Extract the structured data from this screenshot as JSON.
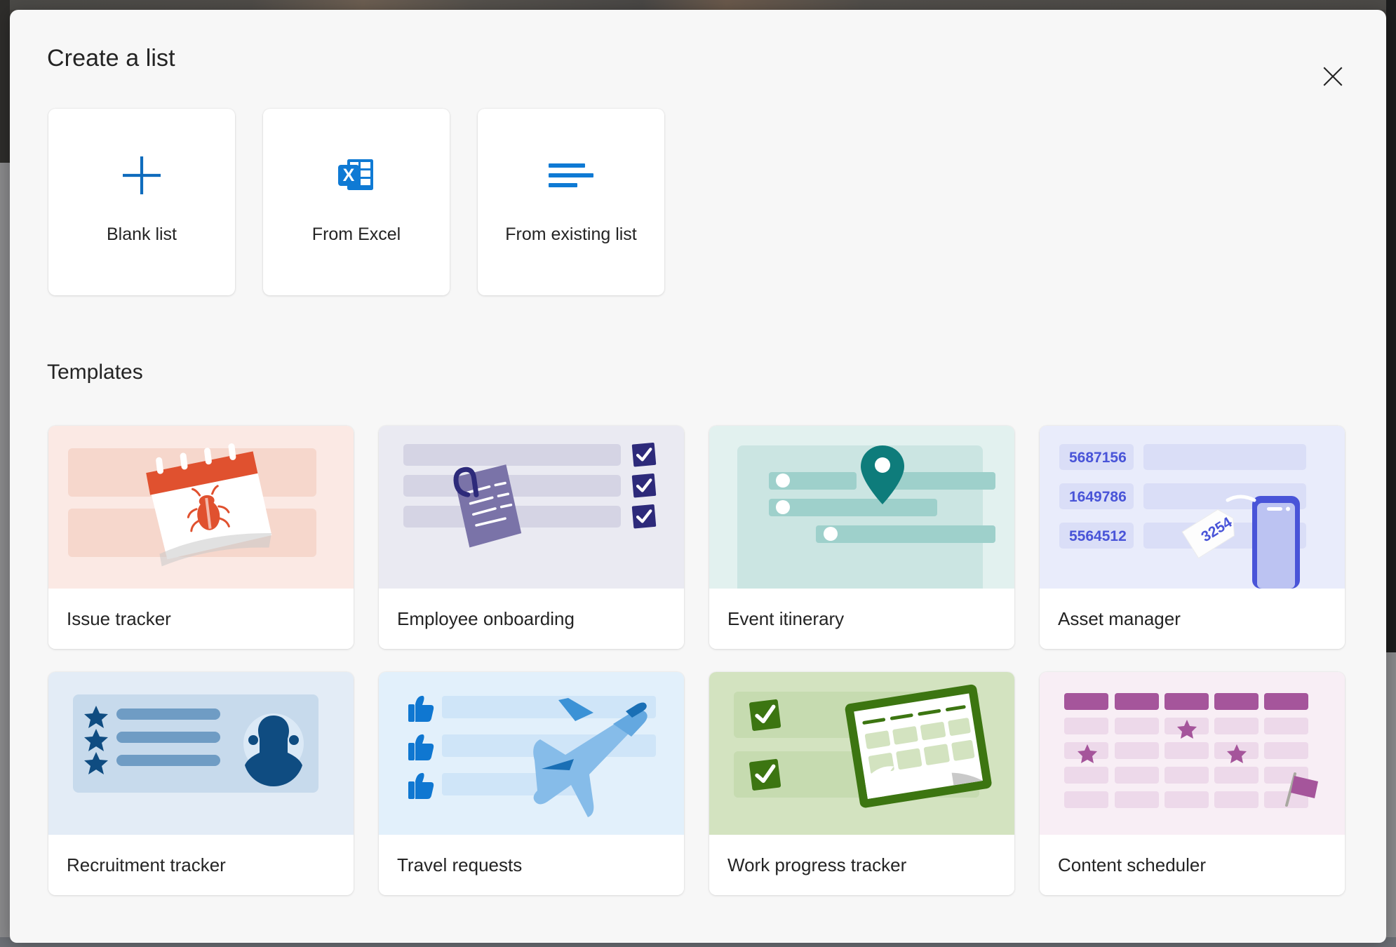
{
  "dialog": {
    "title": "Create a list",
    "close_label": "Close",
    "close_icon": "close-icon"
  },
  "create_options": [
    {
      "label": "Blank list",
      "icon": "plus-icon",
      "accent": "#0f6cbd"
    },
    {
      "label": "From Excel",
      "icon": "excel-icon",
      "accent": "#0f7ad4"
    },
    {
      "label": "From existing list",
      "icon": "list-lines-icon",
      "accent": "#0f7ad4"
    }
  ],
  "templates_section": {
    "heading": "Templates"
  },
  "templates": [
    {
      "name": "Issue tracker",
      "art": "issue-tracker-art",
      "bg": "#fbe9e4",
      "accent": "#e0512f",
      "bar": "#f6d7cc"
    },
    {
      "name": "Employee onboarding",
      "art": "employee-onboarding-art",
      "bg": "#eaeaf2",
      "accent": "#2d2a7a",
      "bar": "#d5d4e4"
    },
    {
      "name": "Event itinerary",
      "art": "event-itinerary-art",
      "bg": "#e2f1ef",
      "accent": "#0e7c7b",
      "bar": "#a9d5d1"
    },
    {
      "name": "Asset manager",
      "art": "asset-manager-art",
      "bg": "#e9ecfb",
      "accent": "#4954d8",
      "bar": "#dadef7",
      "asset_ids": [
        "5687156",
        "1649786",
        "5564512"
      ],
      "tag_number": "3254"
    },
    {
      "name": "Recruitment tracker",
      "art": "recruitment-tracker-art",
      "bg": "#e3ecf6",
      "accent": "#0f4c81",
      "bar": "#7ba4c9"
    },
    {
      "name": "Travel requests",
      "art": "travel-requests-art",
      "bg": "#e2f0fb",
      "accent": "#0f77d1",
      "bar": "#cfe5f8"
    },
    {
      "name": "Work progress tracker",
      "art": "work-progress-tracker-art",
      "bg": "#d3e3c0",
      "accent": "#3c7511",
      "bar": "#c6dbb0"
    },
    {
      "name": "Content scheduler",
      "art": "content-scheduler-art",
      "bg": "#f8eef5",
      "accent": "#a5559b",
      "bar": "#edd9ea"
    }
  ]
}
